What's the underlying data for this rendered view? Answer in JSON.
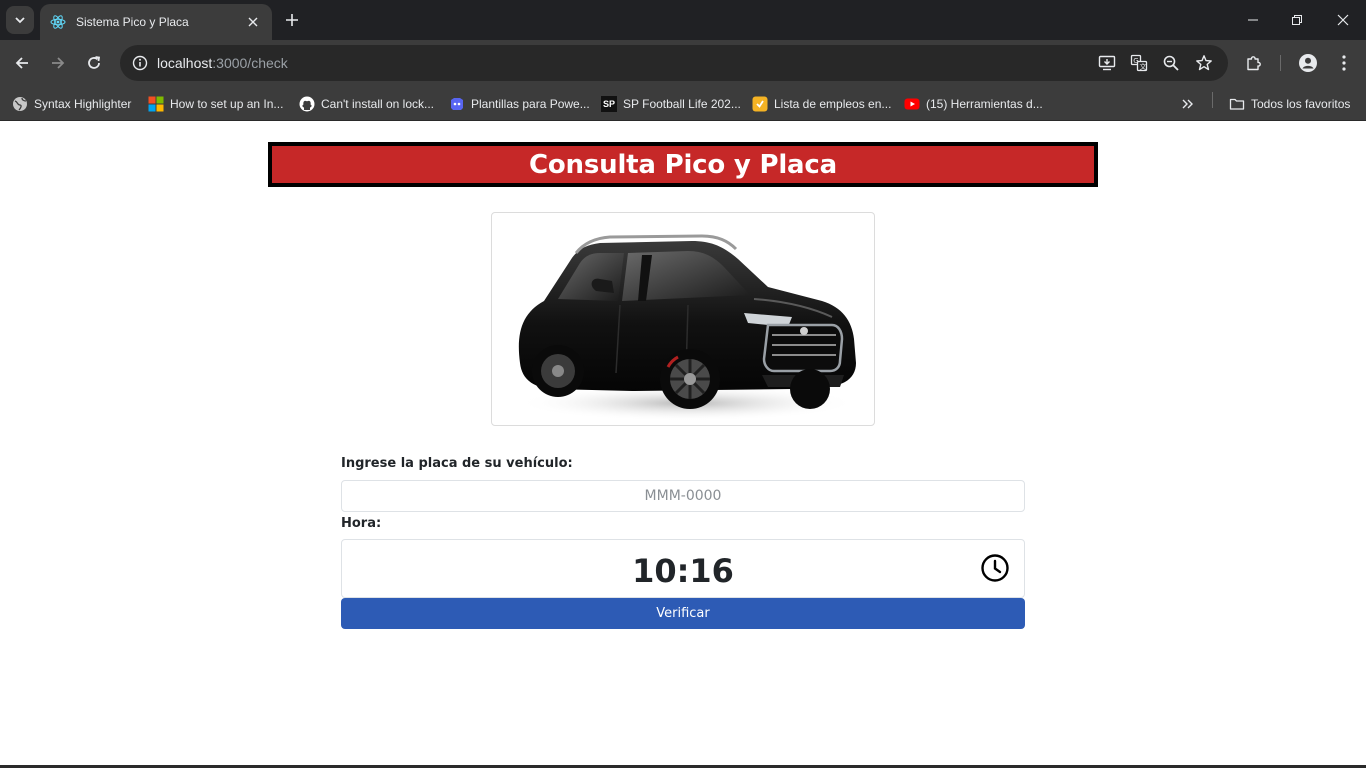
{
  "browser": {
    "tab_title": "Sistema Pico y Placa",
    "url_host": "localhost",
    "url_path": ":3000/check",
    "bookmarks": [
      {
        "label": "Syntax Highlighter",
        "icon": "globe-icon"
      },
      {
        "label": "How to set up an In...",
        "icon": "microsoft-icon"
      },
      {
        "label": "Can't install on lock...",
        "icon": "github-icon"
      },
      {
        "label": "Plantillas para Powe...",
        "icon": "discord-icon"
      },
      {
        "label": "SP Football Life 202...",
        "icon": "sp-icon",
        "icon_text": "SP"
      },
      {
        "label": "Lista de empleos en...",
        "icon": "job-icon"
      },
      {
        "label": "(15) Herramientas d...",
        "icon": "youtube-icon"
      }
    ],
    "all_bookmarks_label": "Todos los favoritos"
  },
  "page": {
    "title": "Consulta Pico y Placa",
    "image": {
      "alt": "black-suv"
    },
    "plate_label": "Ingrese la placa de su vehículo:",
    "plate_placeholder": "MMM-0000",
    "plate_value": "",
    "time_label": "Hora:",
    "time_value": "10:16",
    "verify_label": "Verificar"
  },
  "colors": {
    "header_bg": "#c62828",
    "button_bg": "#2d5bb5"
  }
}
